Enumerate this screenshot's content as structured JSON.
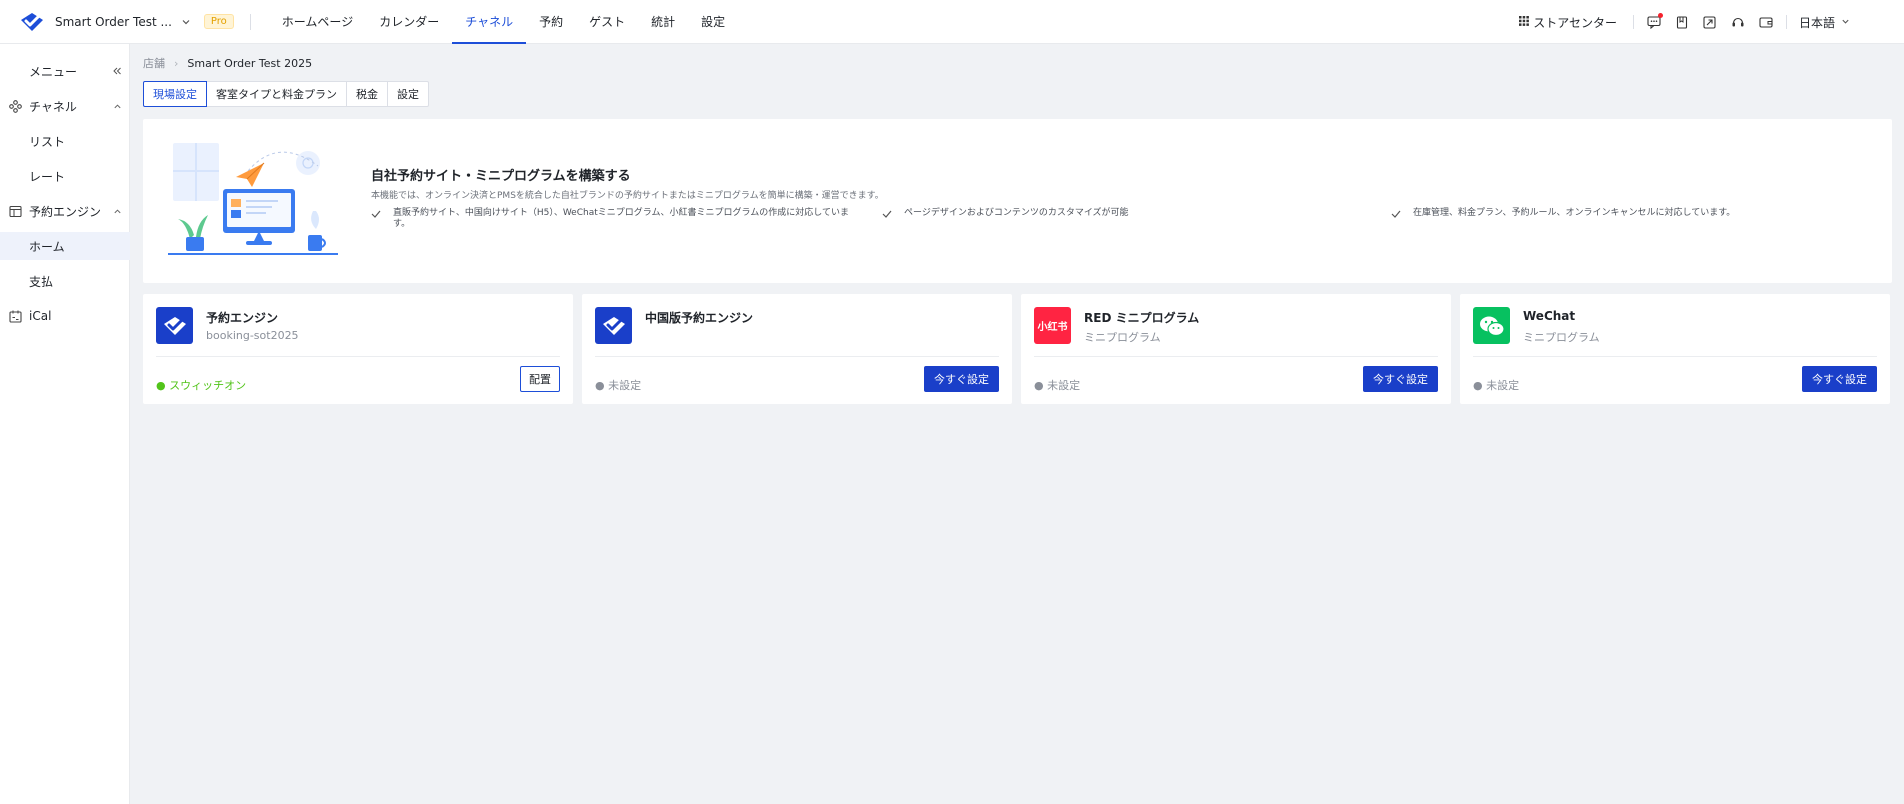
{
  "topbar": {
    "store_name": "Smart Order Test ...",
    "pro_badge": "Pro",
    "nav": [
      "ホームページ",
      "カレンダー",
      "チャネル",
      "予約",
      "ゲスト",
      "統計",
      "設定"
    ],
    "active_nav": "チャネル",
    "store_center": "ストアセンター",
    "language": "日本語",
    "icons": [
      "chat-icon",
      "book-icon",
      "export-icon",
      "headset-icon",
      "wallet-icon"
    ]
  },
  "sidebar": {
    "menu_label": "メニュー",
    "items": [
      {
        "label": "チャネル",
        "icon": "channel-icon",
        "type": "group",
        "expanded": true
      },
      {
        "label": "リスト",
        "type": "child"
      },
      {
        "label": "レート",
        "type": "child"
      },
      {
        "label": "予約エンジン",
        "icon": "booking-engine-icon",
        "type": "group",
        "expanded": true
      },
      {
        "label": "ホーム",
        "type": "child",
        "active": true
      },
      {
        "label": "支払",
        "type": "child"
      },
      {
        "label": "iCal",
        "icon": "calendar-icon",
        "type": "group"
      }
    ]
  },
  "breadcrumb": [
    "店舗",
    "Smart Order Test 2025"
  ],
  "tabs": [
    "現場設定",
    "客室タイプと料金プラン",
    "税金",
    "設定"
  ],
  "banner": {
    "title": "自社予約サイト・ミニプログラムを構築する",
    "description": "本機能では、オンライン決済とPMSを統合した自社ブランドの予約サイトまたはミニプログラムを簡単に構築・運営できます。",
    "features": [
      "直販予約サイト、中国向けサイト（H5）、WeChatミニプログラム、小紅書ミニプログラムの作成に対応しています。",
      "ページデザインおよびコンテンツのカスタマイズが可能",
      "在庫管理、料金プラン、予約ルール、オンラインキャンセルに対応しています。"
    ]
  },
  "cards": [
    {
      "name": "予約エンジン",
      "subtitle": "booking-sot2025",
      "status": "● スウィッチオン",
      "status_on": true,
      "button": "配置",
      "icon": "booking-engine-logo-icon"
    },
    {
      "name": "中国版予約エンジン",
      "subtitle": "",
      "status": "● 未設定",
      "status_on": false,
      "button": "今すぐ設定",
      "icon": "china-booking-engine-logo-icon"
    },
    {
      "name": "RED ミニプログラム",
      "subtitle": "ミニプログラム",
      "status": "● 未設定",
      "status_on": false,
      "button": "今すぐ設定",
      "icon": "xiaohongshu-logo-icon",
      "icon_text": "小红书"
    },
    {
      "name": "WeChat",
      "subtitle": "ミニプログラム",
      "status": "● 未設定",
      "status_on": false,
      "button": "今すぐ設定",
      "icon": "wechat-logo-icon"
    }
  ],
  "colors": {
    "primary": "#1a3fc9",
    "active_text": "#1d4ed8",
    "success": "#52c41a",
    "red_brand": "#ff2442",
    "wechat": "#07c160",
    "background": "#f0f2f5"
  }
}
